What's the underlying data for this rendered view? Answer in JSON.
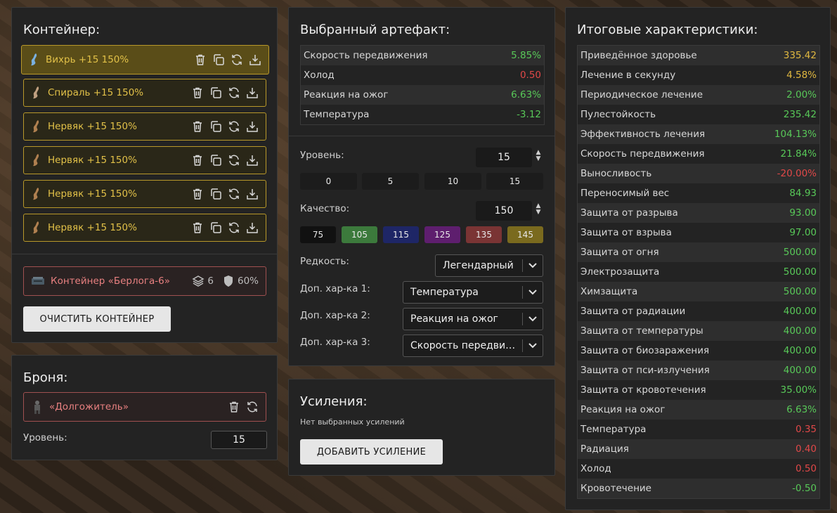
{
  "container": {
    "title": "Контейнер:",
    "items": [
      {
        "label": "Вихрь +15 150%",
        "icon": "vortex-artifact-icon"
      },
      {
        "label": "Спираль +15 150%",
        "icon": "spiral-artifact-icon"
      },
      {
        "label": "Нервяк +15 150%",
        "icon": "nerve-artifact-icon"
      },
      {
        "label": "Нервяк +15 150%",
        "icon": "nerve-artifact-icon"
      },
      {
        "label": "Нервяк +15 150%",
        "icon": "nerve-artifact-icon"
      },
      {
        "label": "Нервяк +15 150%",
        "icon": "nerve-artifact-icon"
      }
    ],
    "box": {
      "label": "Контейнер «Берлога-6»",
      "slots": "6",
      "protection": "60%"
    },
    "clear_label": "ОЧИСТИТЬ КОНТЕЙНЕР"
  },
  "armor": {
    "title": "Броня:",
    "name": "«Долгожитель»",
    "level_label": "Уровень:",
    "level_value": "15"
  },
  "artifact": {
    "title": "Выбранный артефакт:",
    "stats": [
      {
        "name": "Скорость передвижения",
        "value": "5.85%",
        "color": "g"
      },
      {
        "name": "Холод",
        "value": "0.50",
        "color": "r"
      },
      {
        "name": "Реакция на ожог",
        "value": "6.63%",
        "color": "g"
      },
      {
        "name": "Температура",
        "value": "-3.12",
        "color": "g"
      }
    ],
    "level_label": "Уровень:",
    "level_value": "15",
    "level_presets": [
      "0",
      "5",
      "10",
      "15"
    ],
    "quality_label": "Качество:",
    "quality_value": "150",
    "quality_presets": [
      {
        "label": "75",
        "color": "#111111"
      },
      {
        "label": "105",
        "color": "#3c7a3c"
      },
      {
        "label": "115",
        "color": "#1e2666"
      },
      {
        "label": "125",
        "color": "#5e1e6e"
      },
      {
        "label": "135",
        "color": "#7a3434"
      },
      {
        "label": "145",
        "color": "#7a6a1e"
      }
    ],
    "rarity_label": "Редкость:",
    "rarity_value": "Легендарный",
    "extra1_label": "Доп. хар-ка 1:",
    "extra1_value": "Температура",
    "extra2_label": "Доп. хар-ка 2:",
    "extra2_value": "Реакция на ожог",
    "extra3_label": "Доп. хар-ка 3:",
    "extra3_value": "Скорость передвижения"
  },
  "boosts": {
    "title": "Усиления:",
    "empty": "Нет выбранных усилений",
    "add_label": "ДОБАВИТЬ УСИЛЕНИЕ"
  },
  "totals": {
    "title": "Итоговые характеристики:",
    "rows": [
      {
        "name": "Приведённое здоровье",
        "value": "335.42",
        "color": "y"
      },
      {
        "name": "Лечение в секунду",
        "value": "4.58%",
        "color": "y"
      },
      {
        "name": "Периодическое лечение",
        "value": "2.00%",
        "color": "g"
      },
      {
        "name": "Пулестойкость",
        "value": "235.42",
        "color": "g"
      },
      {
        "name": "Эффективность лечения",
        "value": "104.13%",
        "color": "g"
      },
      {
        "name": "Скорость передвижения",
        "value": "21.84%",
        "color": "g"
      },
      {
        "name": "Выносливость",
        "value": "-20.00%",
        "color": "r"
      },
      {
        "name": "Переносимый вес",
        "value": "84.93",
        "color": "g"
      },
      {
        "name": "Защита от разрыва",
        "value": "93.00",
        "color": "g"
      },
      {
        "name": "Защита от взрыва",
        "value": "97.00",
        "color": "g"
      },
      {
        "name": "Защита от огня",
        "value": "500.00",
        "color": "g"
      },
      {
        "name": "Электрозащита",
        "value": "500.00",
        "color": "g"
      },
      {
        "name": "Химзащита",
        "value": "500.00",
        "color": "g"
      },
      {
        "name": "Защита от радиации",
        "value": "400.00",
        "color": "g"
      },
      {
        "name": "Защита от температуры",
        "value": "400.00",
        "color": "g"
      },
      {
        "name": "Защита от биозаражения",
        "value": "400.00",
        "color": "g"
      },
      {
        "name": "Защита от пси-излучения",
        "value": "400.00",
        "color": "g"
      },
      {
        "name": "Защита от кровотечения",
        "value": "35.00%",
        "color": "g"
      },
      {
        "name": "Реакция на ожог",
        "value": "6.63%",
        "color": "g"
      },
      {
        "name": "Температура",
        "value": "0.35",
        "color": "r"
      },
      {
        "name": "Радиация",
        "value": "0.40",
        "color": "r"
      },
      {
        "name": "Холод",
        "value": "0.50",
        "color": "r"
      },
      {
        "name": "Кровотечение",
        "value": "-0.50",
        "color": "g"
      }
    ]
  }
}
